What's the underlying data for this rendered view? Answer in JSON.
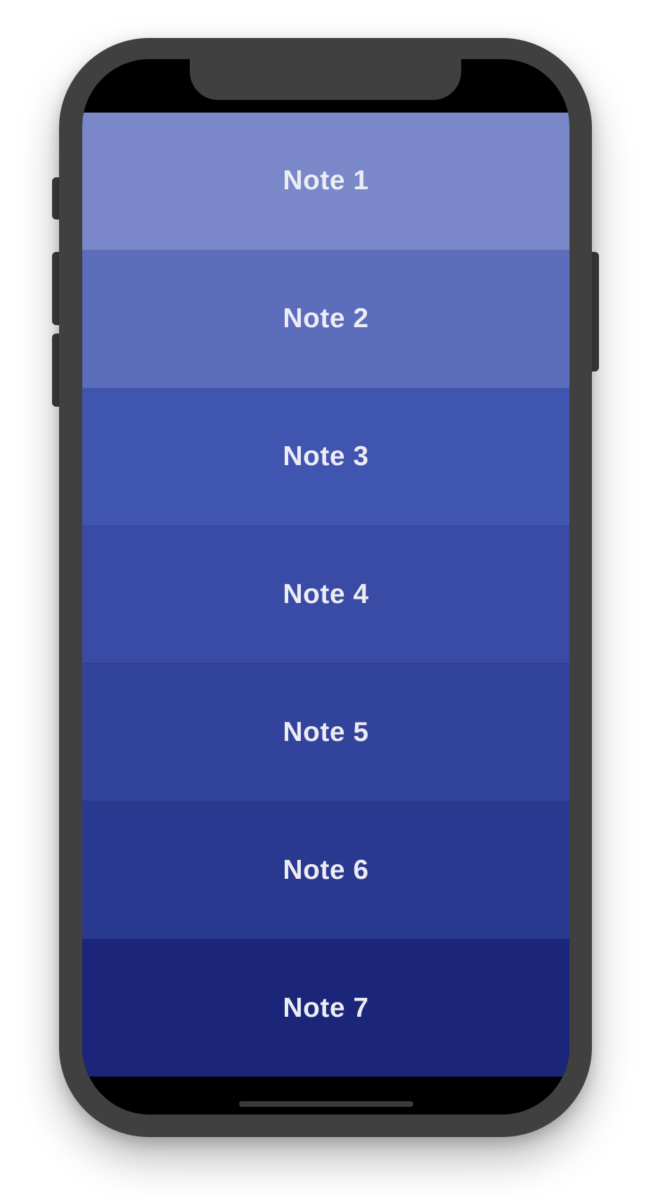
{
  "notes": [
    {
      "label": "Note 1",
      "color": "#7a87c8"
    },
    {
      "label": "Note 2",
      "color": "#5c6dbc"
    },
    {
      "label": "Note 3",
      "color": "#4055b0"
    },
    {
      "label": "Note 4",
      "color": "#3a4ba6"
    },
    {
      "label": "Note 5",
      "color": "#32439b"
    },
    {
      "label": "Note 6",
      "color": "#29398f"
    },
    {
      "label": "Note 7",
      "color": "#1b257a"
    }
  ],
  "colors": {
    "device_frame": "#404040",
    "screen_background": "#000000",
    "label_text": "#ececf4"
  }
}
